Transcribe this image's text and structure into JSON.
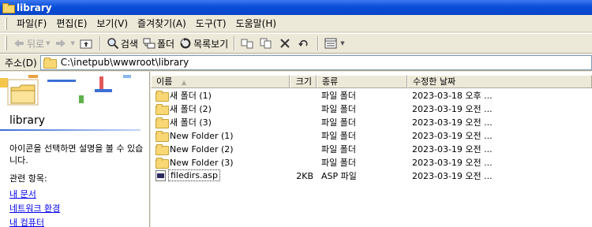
{
  "window": {
    "title": "library"
  },
  "menu": [
    "파일(F)",
    "편집(E)",
    "보기(V)",
    "즐겨찾기(A)",
    "도구(T)",
    "도움말(H)"
  ],
  "toolbar": {
    "back_label": "뒤로",
    "search_label": "검색",
    "folders_label": "폴더",
    "listview_label": "목록보기"
  },
  "address": {
    "label": "주소(D)",
    "path": "C:\\inetpub\\wwwroot\\library"
  },
  "left_pane": {
    "folder_name": "library",
    "description": "아이콘을 선택하면 설명을 볼 수 있습니다.",
    "related_label": "관련 항목:",
    "links": [
      "내 문서",
      "네트워크 환경",
      "내 컴퓨터"
    ]
  },
  "columns": {
    "name": "이름",
    "size": "크기",
    "type": "종류",
    "modified": "수정한 날짜"
  },
  "files": [
    {
      "name": "새 폴더 (1)",
      "size": "",
      "type": "파일 폴더",
      "modified": "2023-03-18 오후 ...",
      "icon": "folder-icon"
    },
    {
      "name": "새 폴더 (2)",
      "size": "",
      "type": "파일 폴더",
      "modified": "2023-03-19 오전 ...",
      "icon": "folder-icon"
    },
    {
      "name": "새 폴더 (3)",
      "size": "",
      "type": "파일 폴더",
      "modified": "2023-03-19 오전 ...",
      "icon": "folder-icon"
    },
    {
      "name": "New Folder (1)",
      "size": "",
      "type": "파일 폴더",
      "modified": "2023-03-19 오전 ...",
      "icon": "folder-icon"
    },
    {
      "name": "New Folder (2)",
      "size": "",
      "type": "파일 폴더",
      "modified": "2023-03-19 오전 ...",
      "icon": "folder-icon"
    },
    {
      "name": "New Folder (3)",
      "size": "",
      "type": "파일 폴더",
      "modified": "2023-03-19 오전 ...",
      "icon": "folder-icon"
    },
    {
      "name": "filedirs.asp",
      "size": "2KB",
      "type": "ASP 파일",
      "modified": "2023-03-19 오전 ...",
      "icon": "asp-file-icon"
    }
  ]
}
